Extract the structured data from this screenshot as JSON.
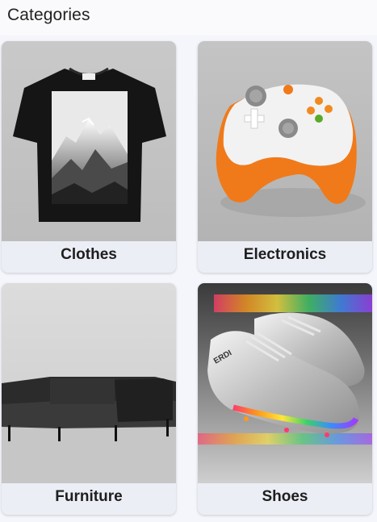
{
  "app": {
    "title": "Categories"
  },
  "categories": [
    {
      "label": "Clothes"
    },
    {
      "label": "Electronics"
    },
    {
      "label": "Furniture"
    },
    {
      "label": "Shoes"
    }
  ],
  "colors": {
    "background": "#f5f6fb",
    "card": "#eceef6",
    "text": "#1e1e1e"
  }
}
